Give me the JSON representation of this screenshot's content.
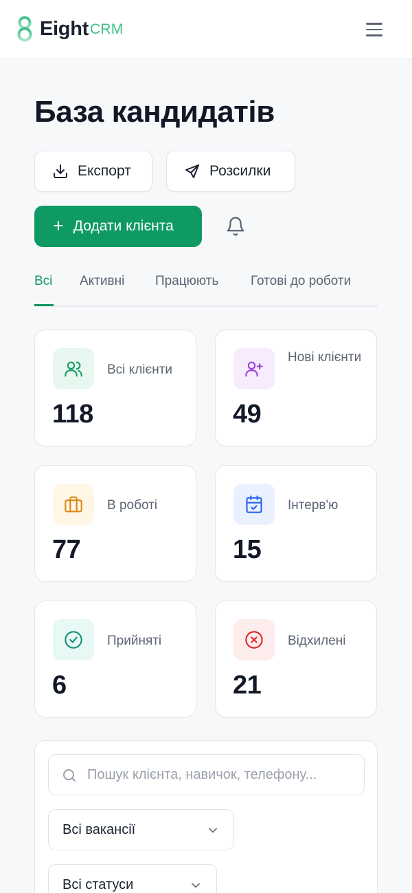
{
  "header": {
    "logo_main": "Eight",
    "logo_sub": "CRM",
    "menu_icon": "hamburger-menu-icon"
  },
  "page": {
    "title": "База кандидатів"
  },
  "actions": {
    "export_label": "Експорт",
    "mailings_label": "Розсилки",
    "add_client_label": "Додати клієнта"
  },
  "tabs": [
    {
      "label": "Всі",
      "active": true
    },
    {
      "label": "Активні",
      "active": false
    },
    {
      "label": "Працюють",
      "active": false
    },
    {
      "label": "Готові до роботи",
      "active": false
    }
  ],
  "stats": [
    {
      "label": "Всі клієнти",
      "value": "118",
      "icon": "users-icon",
      "color": "#0f9a63",
      "bg": "#e8f7ef"
    },
    {
      "label": "Нові клієнти",
      "value": "49",
      "icon": "user-plus-icon",
      "color": "#9b3fd6",
      "bg": "#f6ecfd"
    },
    {
      "label": "В роботі",
      "value": "77",
      "icon": "briefcase-icon",
      "color": "#d9880f",
      "bg": "#fff6e6"
    },
    {
      "label": "Інтерв'ю",
      "value": "15",
      "icon": "calendar-check-icon",
      "color": "#2563eb",
      "bg": "#eaf1fe"
    },
    {
      "label": "Прийняті",
      "value": "6",
      "icon": "check-circle-icon",
      "color": "#14907a",
      "bg": "#e8f8f4"
    },
    {
      "label": "Відхилені",
      "value": "21",
      "icon": "x-circle-icon",
      "color": "#dc2626",
      "bg": "#fdeded"
    }
  ],
  "filters": {
    "search_placeholder": "Пошук клієнта, навичок, телефону...",
    "search_value": "",
    "vacancy_selected": "Всі вакансії",
    "status_selected": "Всі статуси"
  },
  "colors": {
    "accent": "#0f9a63",
    "logo_green": "#3dbf87",
    "text_dark": "#121826",
    "text_muted": "#5b6472",
    "background": "#f7f8fa"
  }
}
